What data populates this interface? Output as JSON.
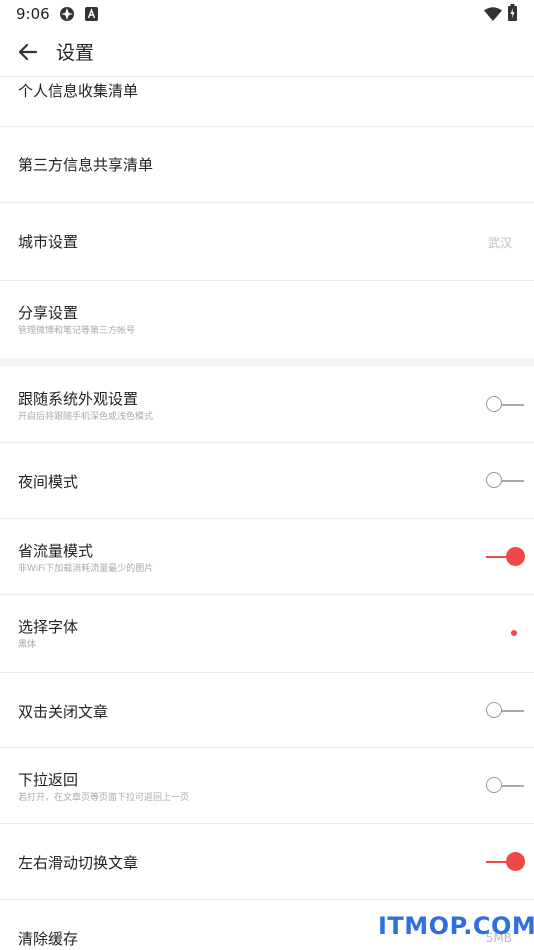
{
  "status_bar": {
    "time": "9:06"
  },
  "header": {
    "title": "设置"
  },
  "rows": {
    "privacy": {
      "title": "个人信息收集清单"
    },
    "third_party": {
      "title": "第三方信息共享清单"
    },
    "city": {
      "title": "城市设置",
      "value": "武汉"
    },
    "share": {
      "title": "分享设置",
      "subtitle": "管理微博和笔记等第三方帐号"
    },
    "follow_system": {
      "title": "跟随系统外观设置",
      "subtitle": "开启后将跟随手机深色或浅色模式",
      "enabled": false
    },
    "night_mode": {
      "title": "夜间模式",
      "enabled": false
    },
    "data_saver": {
      "title": "省流量模式",
      "subtitle": "非WiFi下加载消耗流量最少的图片",
      "enabled": true
    },
    "font": {
      "title": "选择字体",
      "subtitle": "黑体"
    },
    "double_tap": {
      "title": "双击关闭文章",
      "enabled": false
    },
    "pull_back": {
      "title": "下拉返回",
      "subtitle": "若打开，在文章页等页面下拉可返回上一页",
      "enabled": false
    },
    "swipe_switch": {
      "title": "左右滑动切换文章",
      "enabled": true
    },
    "clear_cache": {
      "title": "清除缓存",
      "value": "5MB"
    }
  },
  "watermark": "ITMOP.COM",
  "colors": {
    "accent": "#f04848",
    "watermark": "#2f6fe0"
  },
  "icons": [
    "vpn-icon",
    "app-notification-icon",
    "wifi-icon",
    "battery-icon",
    "back-arrow-icon"
  ]
}
